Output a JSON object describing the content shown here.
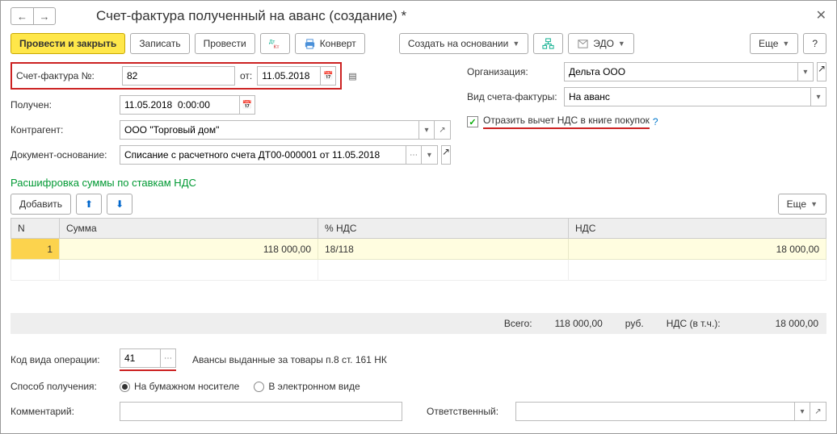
{
  "window": {
    "title": "Счет-фактура полученный на аванс (создание) *"
  },
  "toolbar": {
    "post_close": "Провести и закрыть",
    "save": "Записать",
    "post": "Провести",
    "convert": "Конверт",
    "create_based": "Создать на основании",
    "edo": "ЭДО",
    "more": "Еще"
  },
  "form": {
    "invoice_no_label": "Счет-фактура №:",
    "invoice_no": "82",
    "from_label": "от:",
    "from_date": "11.05.2018",
    "received_label": "Получен:",
    "received": "11.05.2018  0:00:00",
    "counterparty_label": "Контрагент:",
    "counterparty": "ООО \"Торговый дом\"",
    "basis_label": "Документ-основание:",
    "basis": "Списание с расчетного счета ДТ00-000001 от 11.05.2018",
    "org_label": "Организация:",
    "org": "Дельта ООО",
    "invoice_type_label": "Вид счета-фактуры:",
    "invoice_type": "На аванс",
    "vat_deduction": "Отразить вычет НДС в книге покупок"
  },
  "section": {
    "title": "Расшифровка суммы по ставкам НДС",
    "add": "Добавить",
    "more": "Еще"
  },
  "table": {
    "headers": {
      "n": "N",
      "sum": "Сумма",
      "pct": "% НДС",
      "nds": "НДС"
    },
    "rows": [
      {
        "n": "1",
        "sum": "118 000,00",
        "pct": "18/118",
        "nds": "18 000,00"
      }
    ]
  },
  "totals": {
    "total_label": "Всего:",
    "total": "118 000,00",
    "currency": "руб.",
    "vat_label": "НДС (в т.ч.):",
    "vat": "18 000,00"
  },
  "bottom": {
    "op_code_label": "Код вида операции:",
    "op_code": "41",
    "op_code_desc": "Авансы выданные за товары п.8 ст. 161 НК",
    "receive_method_label": "Способ получения:",
    "paper": "На бумажном носителе",
    "electronic": "В электронном виде",
    "comment_label": "Комментарий:",
    "responsible_label": "Ответственный:"
  }
}
